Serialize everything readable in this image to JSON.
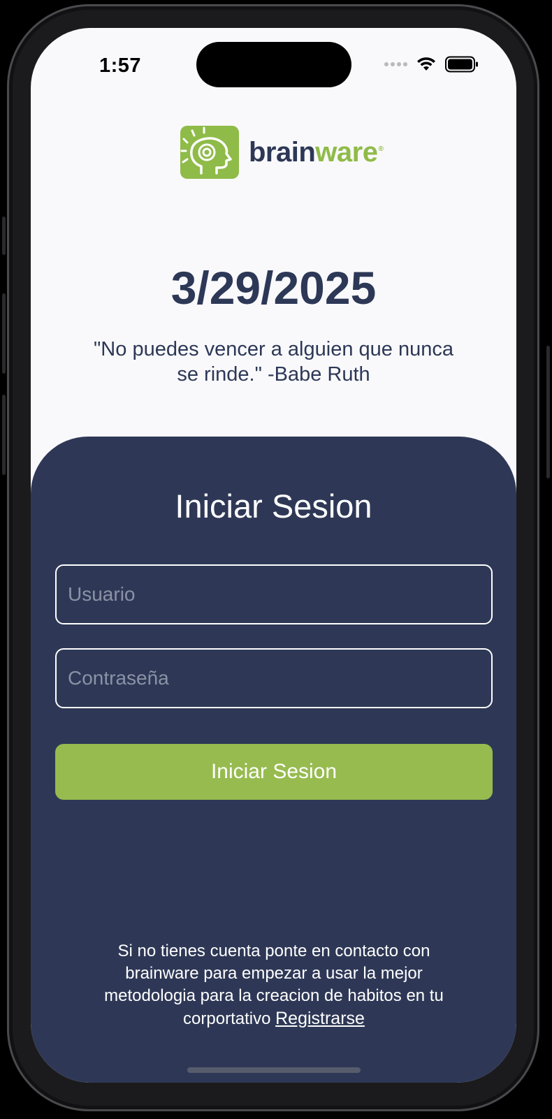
{
  "status_bar": {
    "time": "1:57"
  },
  "logo": {
    "word_dark": "brain",
    "word_green": "ware",
    "registered_mark": "®",
    "icon": "brain-spiral-icon"
  },
  "header": {
    "date": "3/29/2025",
    "quote": "\"No puedes vencer a alguien que nunca se rinde.\" -Babe Ruth"
  },
  "login": {
    "title": "Iniciar Sesion",
    "username_placeholder": "Usuario",
    "username_value": "",
    "password_placeholder": "Contraseña",
    "password_value": "",
    "submit_label": "Iniciar Sesion",
    "footer_text": "Si no tienes cuenta ponte en contacto con brainware para empezar a usar la mejor metodologia para la creacion de habitos en tu corportativo",
    "register_link": "Registrarse"
  },
  "colors": {
    "panel": "#2e3856",
    "accent_green": "#97bb4f",
    "text_dark": "#2d3857",
    "screen_bg": "#f9f9fb"
  }
}
